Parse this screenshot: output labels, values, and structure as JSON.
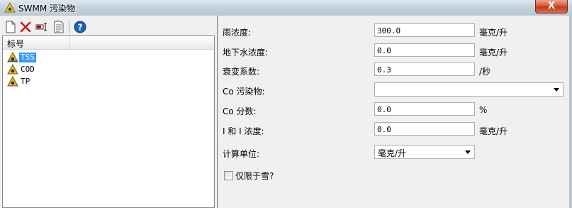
{
  "window": {
    "title": "SWMM 污染物",
    "close_label": "X"
  },
  "toolbar": {
    "buttons": [
      "new-icon",
      "delete-icon",
      "rename-icon",
      "properties-icon",
      "help-icon"
    ]
  },
  "list": {
    "column_header": "标号",
    "items": [
      {
        "label": "TSS",
        "selected": true
      },
      {
        "label": "COD",
        "selected": false
      },
      {
        "label": "TP",
        "selected": false
      }
    ]
  },
  "form": {
    "rain_conc": {
      "label": "雨浓度:",
      "value": "300.0",
      "unit": "毫克/升"
    },
    "gw_conc": {
      "label": "地下水浓度:",
      "value": "0.0",
      "unit": "毫克/升"
    },
    "decay": {
      "label": "衰变系数:",
      "value": "0.3",
      "unit": "/秒"
    },
    "co_pollutant": {
      "label": "Co 污染物:",
      "value": ""
    },
    "co_fraction": {
      "label": "Co 分数:",
      "value": "0.0",
      "unit": "%"
    },
    "ii_conc": {
      "label": "I 和 I 浓度:",
      "value": "0.0",
      "unit": "毫克/升"
    },
    "units": {
      "label": "计算单位:",
      "value": "毫克/升"
    },
    "snow_only": {
      "label": "仅限于雪?",
      "checked": false
    }
  }
}
